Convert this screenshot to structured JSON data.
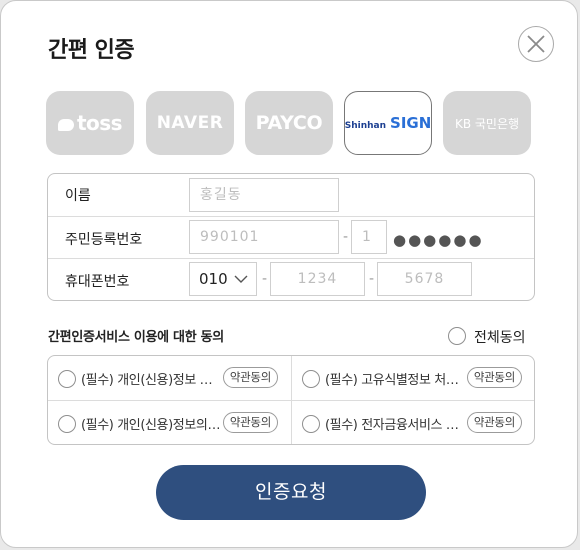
{
  "modal": {
    "title": "간편 인증"
  },
  "providers": {
    "items": [
      {
        "key": "toss",
        "label": "toss",
        "selected": false
      },
      {
        "key": "naver",
        "label": "NAVER",
        "selected": false
      },
      {
        "key": "payco",
        "label": "PAYCO",
        "selected": false
      },
      {
        "key": "shinhan",
        "label_a": "Shinhan",
        "label_b": "SIGN",
        "selected": true
      },
      {
        "key": "kb",
        "label": "KB 국민은행",
        "selected": false
      }
    ]
  },
  "form": {
    "name": {
      "label": "이름",
      "placeholder": "홍길동"
    },
    "rrn": {
      "label": "주민등록번호",
      "front_placeholder": "990101",
      "dash": "-",
      "back_placeholder": "1",
      "masked": "●●●●●●"
    },
    "phone": {
      "label": "휴대폰번호",
      "prefix": "010",
      "dash": "-",
      "mid_placeholder": "1234",
      "last_placeholder": "5678"
    }
  },
  "agreement": {
    "title": "간편인증서비스 이용에 대한 동의",
    "all_label": "전체동의",
    "terms": [
      {
        "text": "(필수) 개인(신용)정보 …",
        "button": "약관동의"
      },
      {
        "text": "(필수) 고유식별정보 처…",
        "button": "약관동의"
      },
      {
        "text": "(필수) 개인(신용)정보의…",
        "button": "약관동의"
      },
      {
        "text": "(필수) 전자금융서비스 …",
        "button": "약관동의"
      }
    ]
  },
  "submit_label": "인증요청",
  "colors": {
    "primary": "#2f4f7f",
    "provider_bg": "#d6d6d6",
    "shinhan_blue": "#2a6fd6"
  }
}
